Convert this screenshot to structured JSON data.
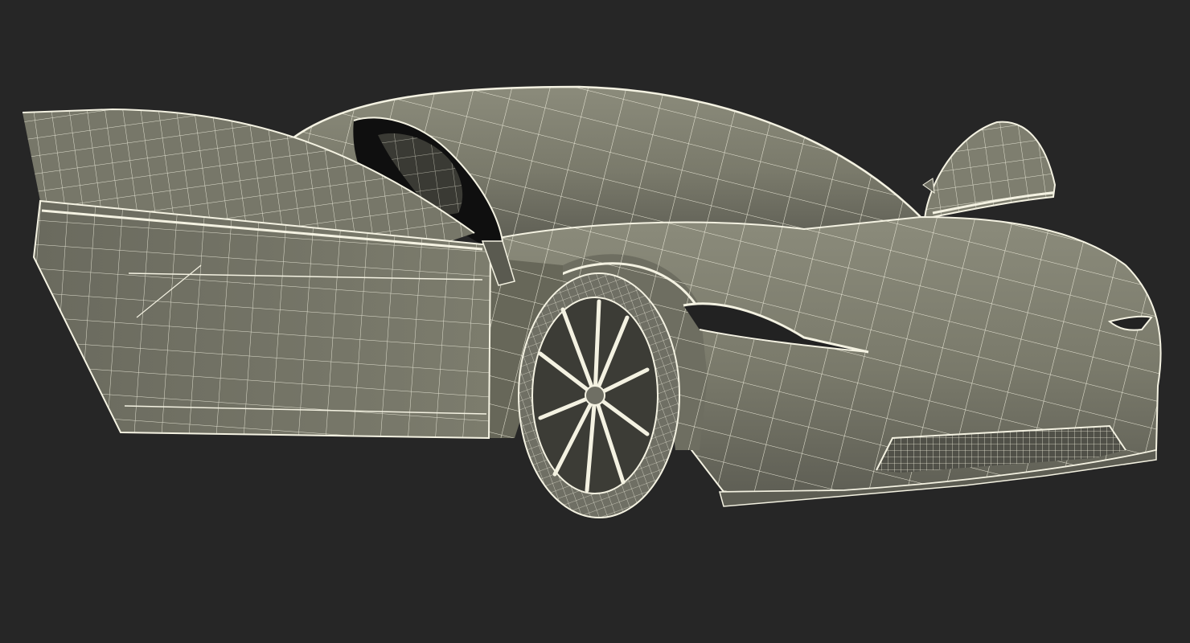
{
  "scene": {
    "background": "#262626",
    "subject": "sports-car-wireframe",
    "colors": {
      "surface": "#7a7a6c",
      "surface_light": "#8a8a7a",
      "surface_dark": "#5c5c52",
      "wire": "#f4f2e2",
      "interior": "#111111",
      "tire": "#6f6f64"
    },
    "icons": [
      "car-body",
      "front-wheel",
      "open-door",
      "rear-door"
    ]
  }
}
